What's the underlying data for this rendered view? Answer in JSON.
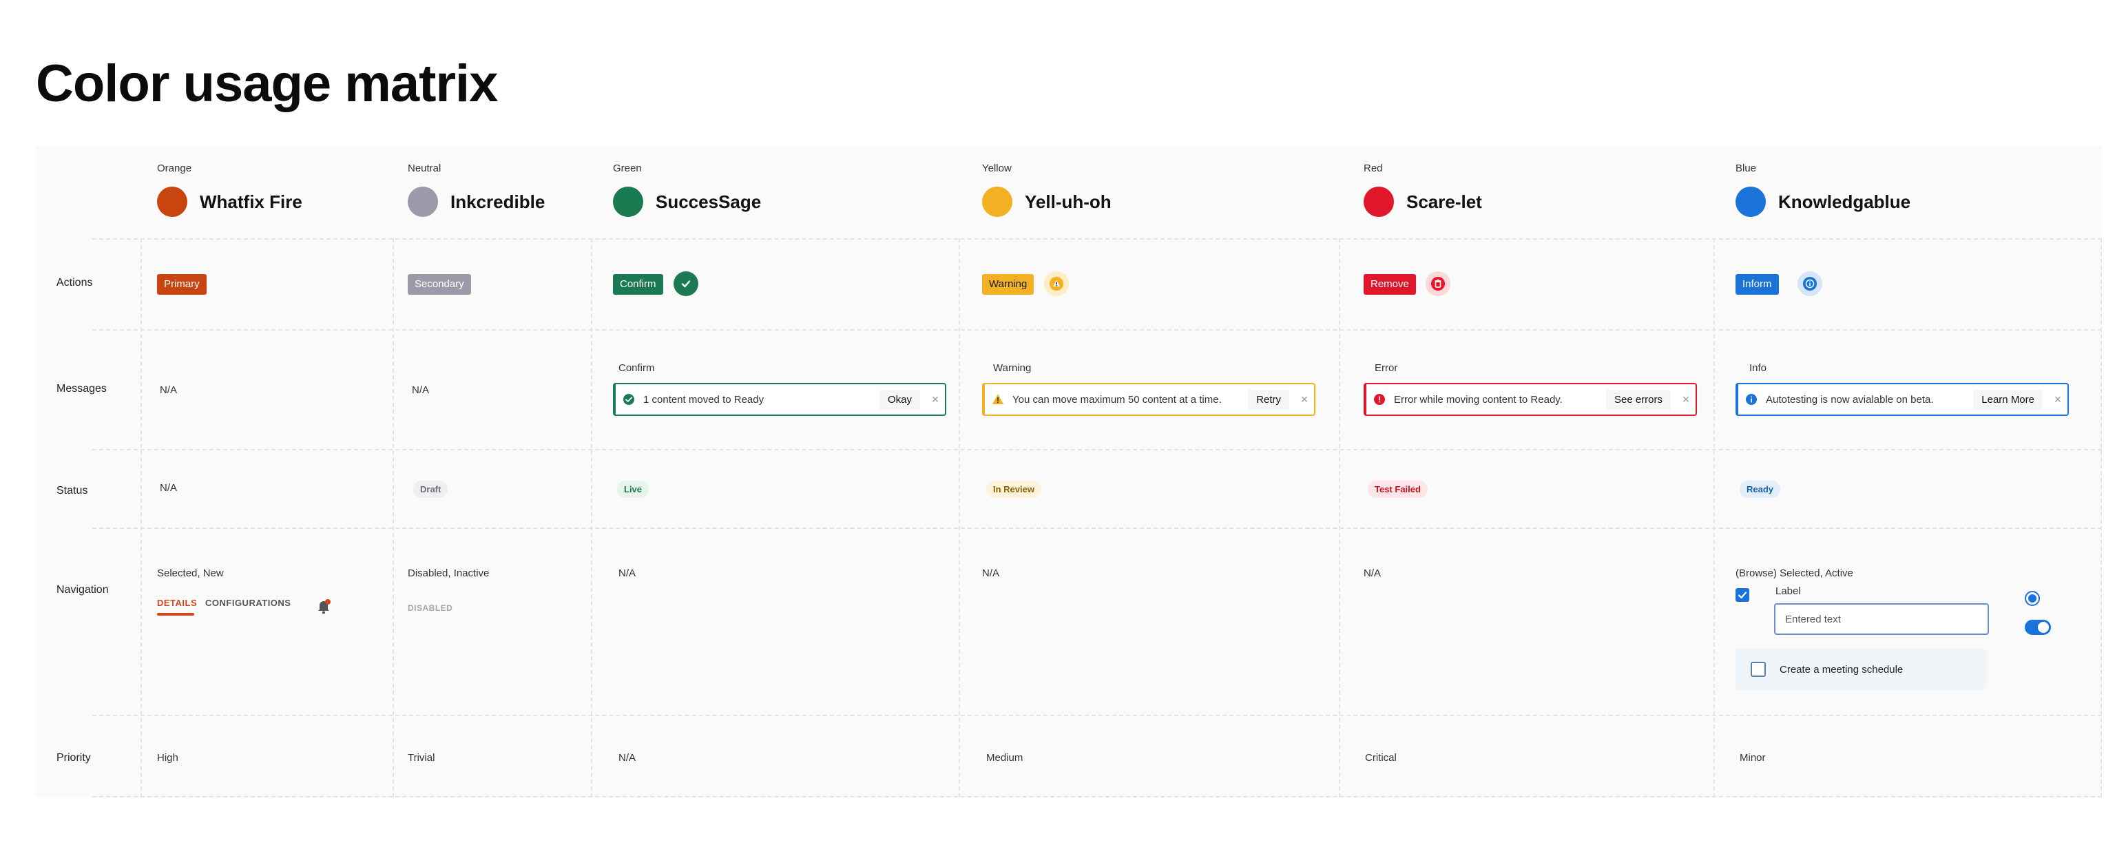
{
  "page": {
    "title": "Color usage matrix"
  },
  "columns": [
    {
      "category": "Orange",
      "name": "Whatfix Fire",
      "color": "#c9450f"
    },
    {
      "category": "Neutral",
      "name": "Inkcredible",
      "color": "#9c9aa8"
    },
    {
      "category": "Green",
      "name": "SuccesSage",
      "color": "#1a7a52"
    },
    {
      "category": "Yellow",
      "name": "Yell-uh-oh",
      "color": "#f2b022"
    },
    {
      "category": "Red",
      "name": "Scare-let",
      "color": "#e0162b"
    },
    {
      "category": "Blue",
      "name": "Knowledgablue",
      "color": "#1a73d9"
    }
  ],
  "rows": {
    "actions": "Actions",
    "messages": "Messages",
    "status": "Status",
    "navigation": "Navigation",
    "priority": "Priority"
  },
  "actions": {
    "orange": "Primary",
    "neutral": "Secondary",
    "green": "Confirm",
    "yellow": "Warning",
    "red": "Remove",
    "blue": "Inform"
  },
  "messages": {
    "orange": "N/A",
    "neutral": "N/A",
    "green": {
      "caption": "Confirm",
      "text": "1 content moved to Ready",
      "action": "Okay"
    },
    "yellow": {
      "caption": "Warning",
      "text": "You can move maximum 50 content at a time.",
      "action": "Retry"
    },
    "red": {
      "caption": "Error",
      "text": "Error while moving content to Ready.",
      "action": "See errors"
    },
    "blue": {
      "caption": "Info",
      "text": "Autotesting is now avialable on beta.",
      "action": "Learn More"
    }
  },
  "status": {
    "orange": "N/A",
    "neutral": "Draft",
    "green": "Live",
    "yellow": "In Review",
    "red": "Test Failed",
    "blue": "Ready"
  },
  "navigation": {
    "orange": {
      "caption": "Selected, New",
      "tab_active": "DETAILS",
      "tab_inactive": "CONFIGURATIONS"
    },
    "neutral": {
      "caption": "Disabled, Inactive",
      "tab_disabled": "DISABLED"
    },
    "green": "N/A",
    "yellow": "N/A",
    "red": "N/A",
    "blue": {
      "caption": "(Browse) Selected, Active",
      "field_label": "Label",
      "field_value": "Entered text",
      "checkbox_label": "Create a meeting schedule"
    }
  },
  "priority": {
    "orange": "High",
    "neutral": "Trivial",
    "green": "N/A",
    "yellow": "Medium",
    "red": "Critical",
    "blue": "Minor"
  },
  "icons": {
    "green_action": "check-circle-icon",
    "yellow_action": "alert-icon",
    "red_action": "trash-icon",
    "blue_action": "info-icon",
    "notification": "bell-icon",
    "close": "close-icon"
  }
}
